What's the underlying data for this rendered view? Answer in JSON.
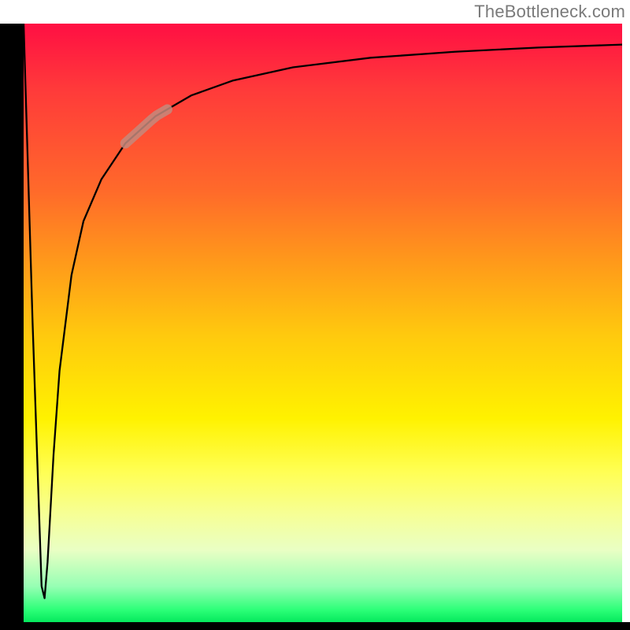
{
  "watermark": {
    "text": "TheBottleneck.com"
  },
  "chart_data": {
    "type": "line",
    "title": "",
    "xlabel": "",
    "ylabel": "",
    "xlim": [
      0,
      100
    ],
    "ylim": [
      0,
      100
    ],
    "grid": false,
    "legend": false,
    "series": [
      {
        "name": "bottleneck-curve",
        "x": [
          0,
          1.5,
          3,
          3.5,
          4,
          5,
          6,
          8,
          10,
          13,
          17,
          22,
          28,
          35,
          45,
          58,
          72,
          86,
          100
        ],
        "y": [
          100,
          50,
          6,
          4,
          10,
          28,
          42,
          58,
          67,
          74,
          80,
          84.5,
          88,
          90.5,
          92.7,
          94.3,
          95.3,
          96,
          96.5
        ]
      }
    ],
    "highlight_segment": {
      "series": "bottleneck-curve",
      "x_range": [
        17,
        24
      ],
      "y_range": [
        80,
        85.5
      ],
      "color": "#c48a7d"
    },
    "background_gradient": {
      "direction": "vertical",
      "stops": [
        {
          "pos": 0.0,
          "color": "#ff0f43"
        },
        {
          "pos": 0.28,
          "color": "#ff6a2a"
        },
        {
          "pos": 0.52,
          "color": "#ffc90e"
        },
        {
          "pos": 0.75,
          "color": "#ffff55"
        },
        {
          "pos": 0.94,
          "color": "#97ffb4"
        },
        {
          "pos": 1.0,
          "color": "#05e85d"
        }
      ]
    }
  }
}
